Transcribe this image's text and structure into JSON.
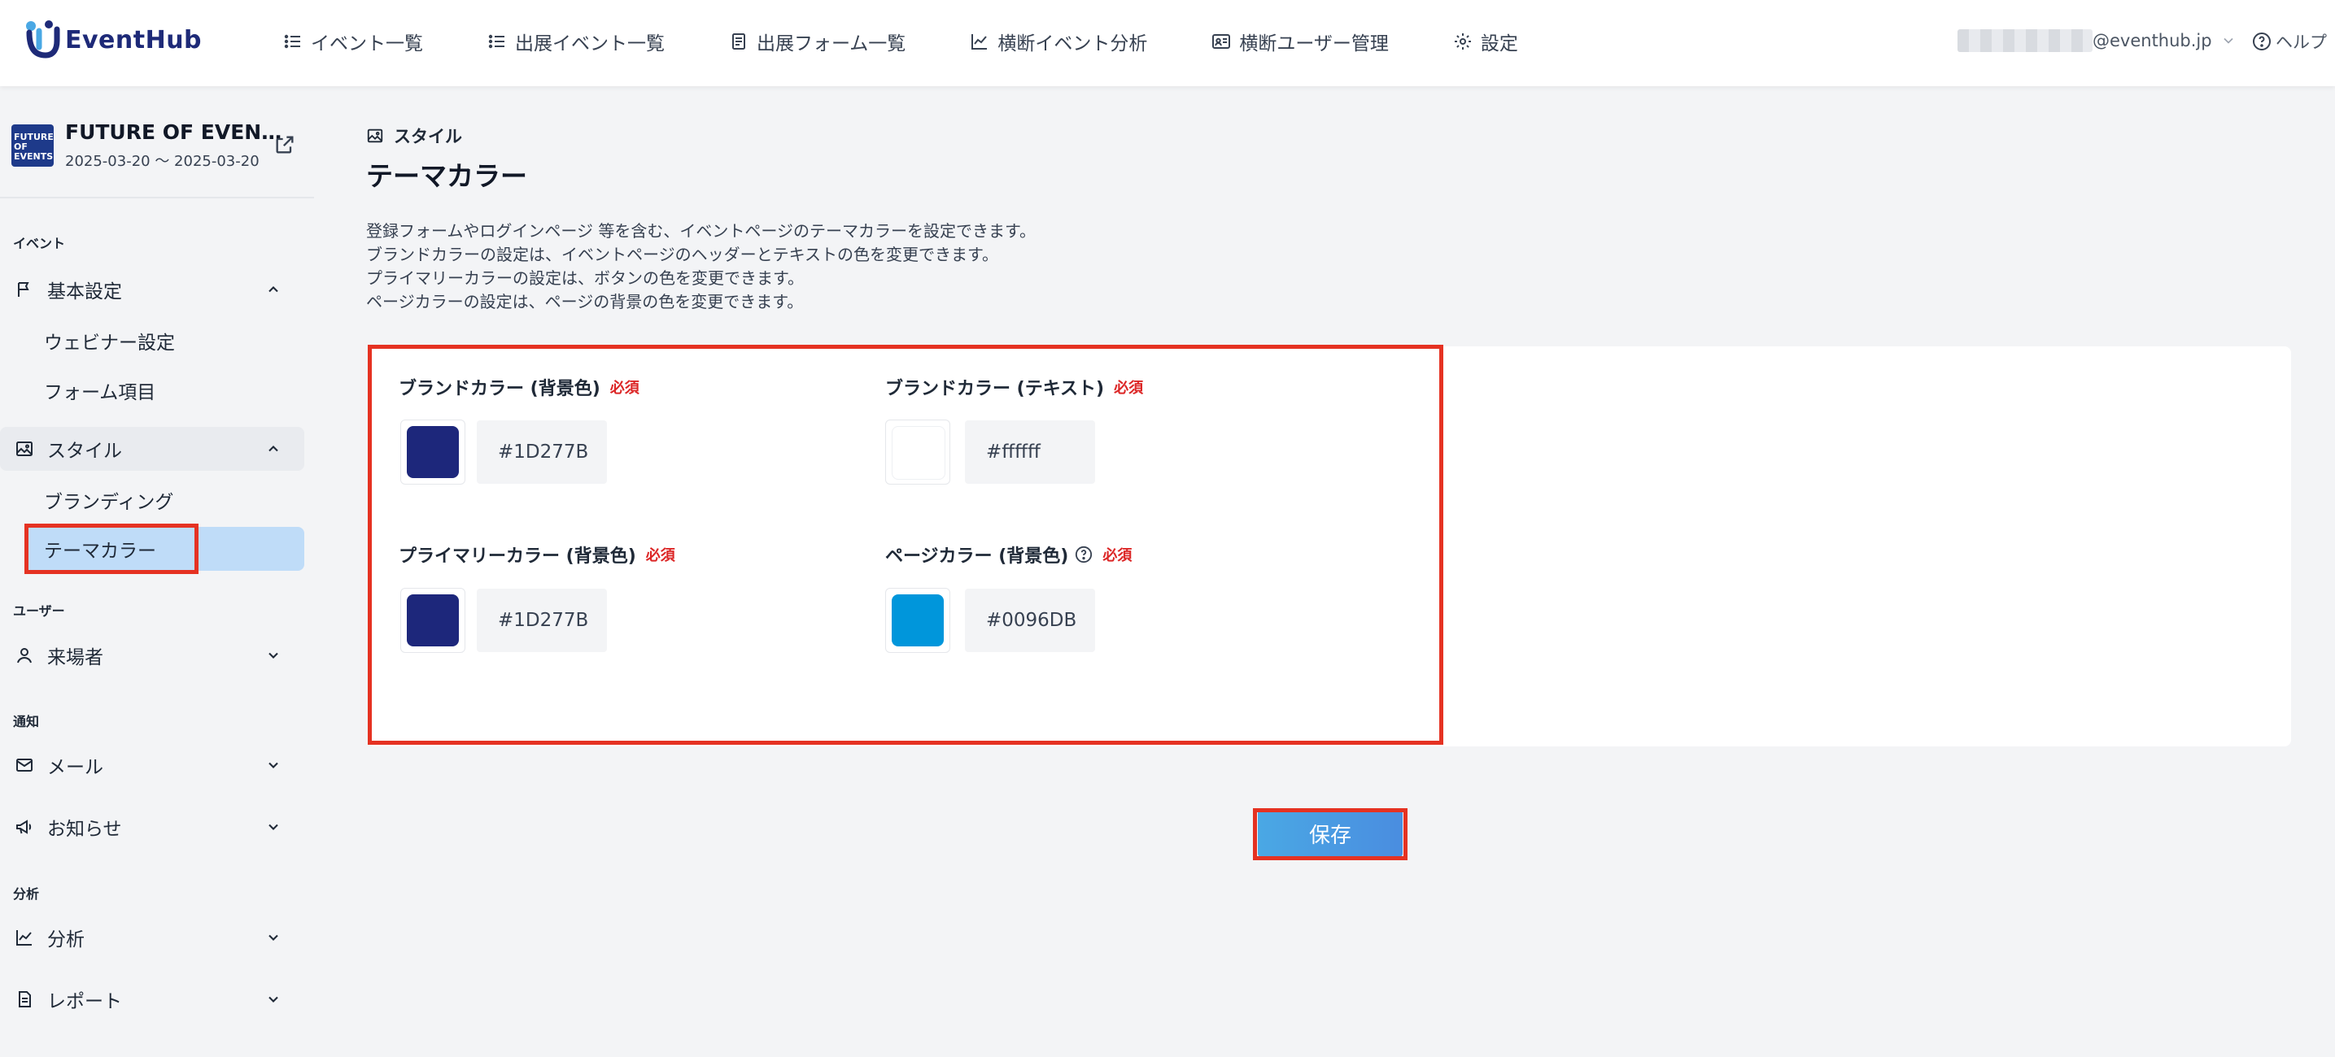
{
  "header": {
    "logo_text": "EventHub",
    "nav": [
      {
        "label": "イベント一覧",
        "icon": "list-icon"
      },
      {
        "label": "出展イベント一覧",
        "icon": "list-icon"
      },
      {
        "label": "出展フォーム一覧",
        "icon": "form-icon"
      },
      {
        "label": "横断イベント分析",
        "icon": "chart-icon"
      },
      {
        "label": "横断ユーザー管理",
        "icon": "id-card-icon"
      },
      {
        "label": "設定",
        "icon": "gear-icon"
      }
    ],
    "user_email": "@eventhub.jp",
    "help_label": "ヘルプ"
  },
  "sidebar": {
    "event_title": "FUTURE OF EVEN…",
    "event_thumb_text": "FUTURE OF EVENTS",
    "event_date": "2025-03-20 〜 2025-03-20",
    "sections": {
      "event": "イベント",
      "user": "ユーザー",
      "notify": "通知",
      "analysis": "分析"
    },
    "items": {
      "basic": "基本設定",
      "webinar": "ウェビナー設定",
      "form": "フォーム項目",
      "style": "スタイル",
      "branding": "ブランディング",
      "theme": "テーマカラー",
      "visitor": "来場者",
      "mail": "メール",
      "notice": "お知らせ",
      "analysis": "分析",
      "report": "レポート"
    }
  },
  "main": {
    "breadcrumb": "スタイル",
    "title": "テーマカラー",
    "description": [
      "登録フォームやログインページ 等を含む、イベントページのテーマカラーを設定できます。",
      "ブランドカラーの設定は、イベントページのヘッダーとテキストの色を変更できます。",
      "プライマリーカラーの設定は、ボタンの色を変更できます。",
      "ページカラーの設定は、ページの背景の色を変更できます。"
    ],
    "required_label": "必須",
    "fields": {
      "brand_bg": {
        "label": "ブランドカラー (背景色)",
        "value": "#1D277B",
        "color": "#1D277B"
      },
      "brand_text": {
        "label": "ブランドカラー (テキスト)",
        "value": "#ffffff",
        "color": "#ffffff"
      },
      "primary_bg": {
        "label": "プライマリーカラー (背景色)",
        "value": "#1D277B",
        "color": "#1D277B"
      },
      "page_bg": {
        "label": "ページカラー (背景色)",
        "value": "#0096DB",
        "color": "#0096DB"
      }
    },
    "save_label": "保存"
  },
  "colors": {
    "brand": "#1e2a78",
    "highlight": "#e53222",
    "active_bg": "#bfdcf8",
    "save_gradient_start": "#4aa8e4",
    "save_gradient_end": "#4a8de0"
  }
}
